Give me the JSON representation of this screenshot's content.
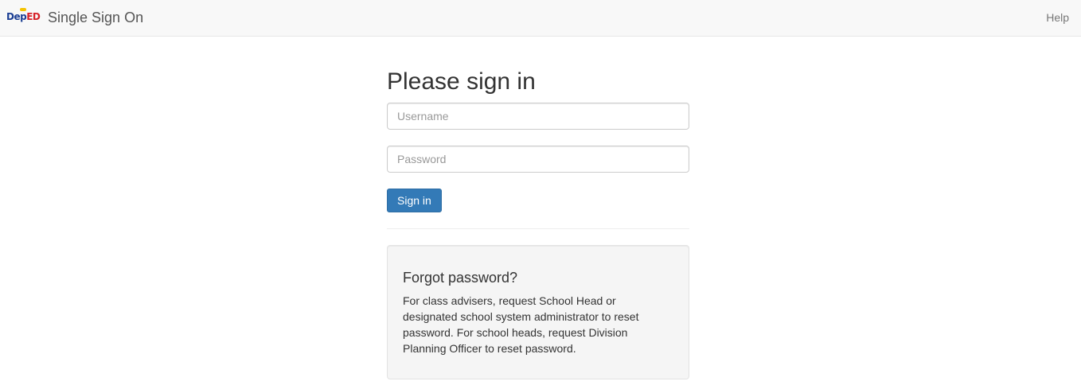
{
  "navbar": {
    "logo": {
      "dep": "Dep",
      "ed": "ED"
    },
    "title": "Single Sign On",
    "help_label": "Help"
  },
  "form": {
    "heading": "Please sign in",
    "username_placeholder": "Username",
    "password_placeholder": "Password",
    "submit_label": "Sign in"
  },
  "forgot": {
    "title": "Forgot password?",
    "text": "For class advisers, request School Head or designated school system administrator to reset password. For school heads, request Division Planning Officer to reset password."
  },
  "colors": {
    "navbar_bg": "#f8f8f8",
    "primary": "#337ab7",
    "well_bg": "#f5f5f5"
  }
}
